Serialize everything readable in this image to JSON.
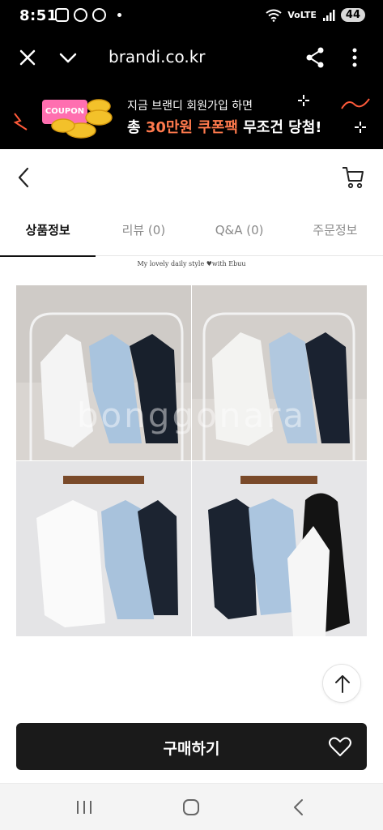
{
  "status_bar": {
    "time": "8:51",
    "network_label": "VoLTE",
    "battery": "44",
    "icons": [
      "screenshot-icon",
      "cup-icon",
      "talk-icon",
      "wifi-icon",
      "signal-icon",
      "battery-icon"
    ]
  },
  "browser": {
    "url": "brandi.co.kr",
    "icons": [
      "close-icon",
      "chevron-down-icon",
      "share-icon",
      "more-icon"
    ]
  },
  "banner": {
    "line1": "지금 브랜디 회원가입 하면",
    "line2_prefix": "총 ",
    "line2_highlight": "30만원 쿠폰팩",
    "line2_suffix": " 무조건 당첨!",
    "coupon_label": "COUPON",
    "accent_color": "#ff7a4d"
  },
  "page": {
    "icons": [
      "back-icon",
      "cart-icon"
    ]
  },
  "tabs": [
    {
      "label": "상품정보",
      "active": true
    },
    {
      "label": "리뷰 (0)",
      "active": false
    },
    {
      "label": "Q&A (0)",
      "active": false
    },
    {
      "label": "주문정보",
      "active": false
    }
  ],
  "product": {
    "caption": "My lovely daily style ♥with Ebuu",
    "watermark": "bonggonara"
  },
  "actions": {
    "buy_label": "구매하기",
    "icons": [
      "arrow-up-icon",
      "heart-icon"
    ]
  },
  "nav": {
    "icons": [
      "recent-apps-icon",
      "home-icon",
      "back-nav-icon"
    ]
  }
}
